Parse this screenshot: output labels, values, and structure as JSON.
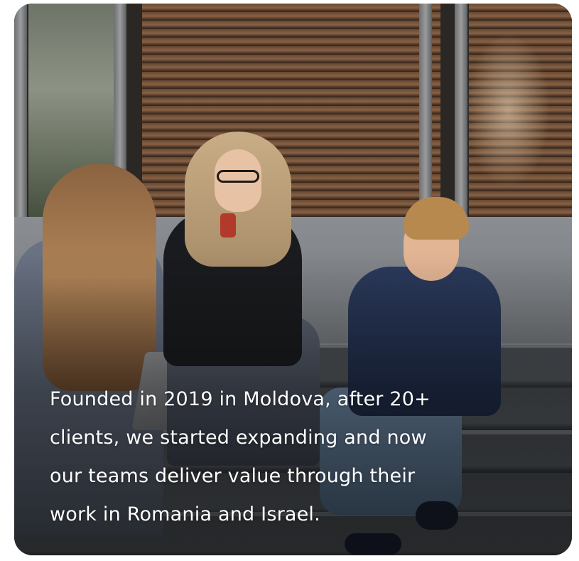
{
  "card": {
    "image": "photo of three people sitting on outdoor steps",
    "caption_lines": [
      "Founded in 2019 in Moldova, after 20+",
      "clients, we started expanding and now",
      "our teams deliver value through their",
      "work in Romania and Israel."
    ]
  },
  "colors": {
    "caption_text": "#ffffff",
    "page_background": "#ffffff"
  }
}
